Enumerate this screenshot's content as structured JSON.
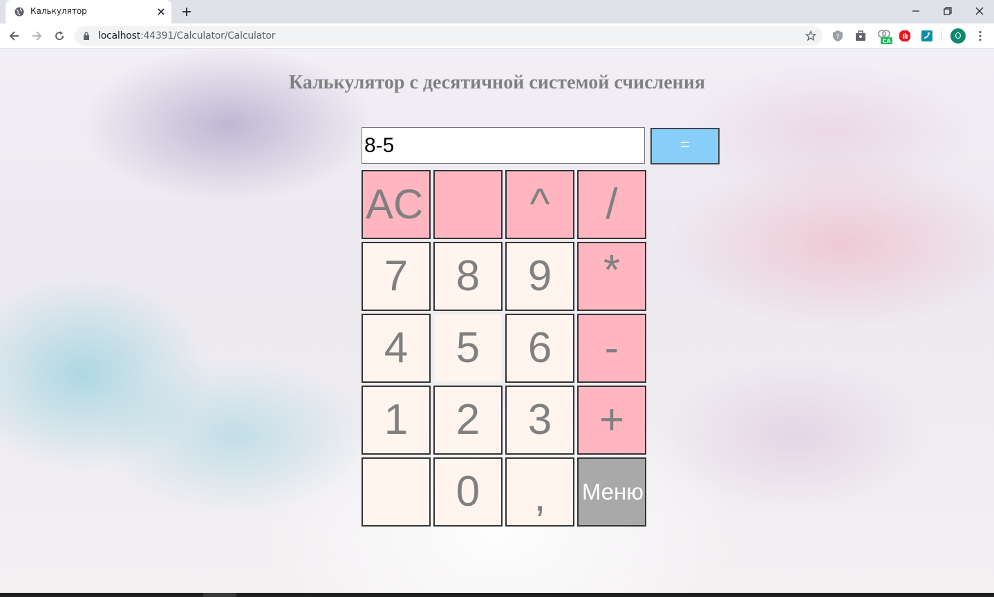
{
  "browser": {
    "tab_title": "Калькулятор",
    "url_host": "localhost",
    "url_rest": ":44391/Calculator/Calculator",
    "profile_initial": "O",
    "extension_badge": "CA"
  },
  "page": {
    "title": "Калькулятор с десятичной системой счисления",
    "display_value": "8-5",
    "equals_label": "=",
    "keys": {
      "ac": "AC",
      "blank_top": "",
      "power": "^",
      "divide": "/",
      "seven": "7",
      "eight": "8",
      "nine": "9",
      "multiply": "*",
      "four": "4",
      "five": "5",
      "six": "6",
      "minus": "-",
      "one": "1",
      "two": "2",
      "three": "3",
      "plus": "+",
      "blank_bottom": "",
      "zero": "0",
      "comma": ",",
      "menu": "Меню"
    }
  },
  "colors": {
    "operator_key": "#ffb6c1",
    "digit_key": "#fff5ee",
    "menu_key": "#a9a9a9",
    "equals_key": "#87cefa",
    "title_text": "#808080"
  }
}
